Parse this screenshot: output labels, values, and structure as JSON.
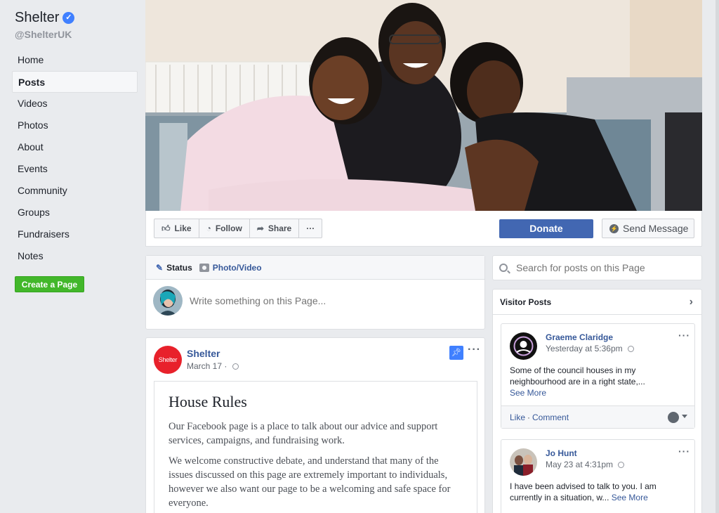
{
  "page": {
    "name": "Shelter",
    "verified_glyph": "✓",
    "handle": "@ShelterUK"
  },
  "sidebar": {
    "items": [
      {
        "label": "Home"
      },
      {
        "label": "Posts",
        "active": true
      },
      {
        "label": "Videos"
      },
      {
        "label": "Photos"
      },
      {
        "label": "About"
      },
      {
        "label": "Events"
      },
      {
        "label": "Community"
      },
      {
        "label": "Groups"
      },
      {
        "label": "Fundraisers"
      },
      {
        "label": "Notes"
      }
    ],
    "create_page_label": "Create a Page"
  },
  "actions": {
    "like": "Like",
    "follow": "Follow",
    "share": "Share",
    "more": "···",
    "donate": "Donate",
    "send_message": "Send Message"
  },
  "composer": {
    "tab_status": "Status",
    "tab_photo": "Photo/Video",
    "placeholder": "Write something on this Page..."
  },
  "post": {
    "logo_text": "Shelter",
    "author": "Shelter",
    "date": "March 17 ·",
    "more": "···",
    "note_title": "House Rules",
    "paragraphs": [
      "Our Facebook page is a place to talk about our advice and support services, campaigns, and fundraising work.",
      "We welcome constructive debate, and understand that many of the issues discussed on this page are extremely important to individuals, however we also want our page to be a welcoming and safe space for everyone."
    ]
  },
  "search": {
    "placeholder": "Search for posts on this Page"
  },
  "visitor_posts": {
    "title": "Visitor Posts",
    "items": [
      {
        "name": "Graeme Claridge",
        "time": "Yesterday at 5:36pm",
        "text": "Some of the council houses in my neighbourhood are in a right state,...",
        "see_more": "See More",
        "like": "Like",
        "comment": "Comment"
      },
      {
        "name": "Jo Hunt",
        "time": "May 23 at 4:31pm",
        "text": "I have been advised to talk to you. I am currently in a situation, w...",
        "see_more": "See More"
      }
    ]
  },
  "colors": {
    "brand_blue": "#4267b2",
    "link_blue": "#365899",
    "green": "#42b72a",
    "shelter_red": "#e8212b"
  }
}
